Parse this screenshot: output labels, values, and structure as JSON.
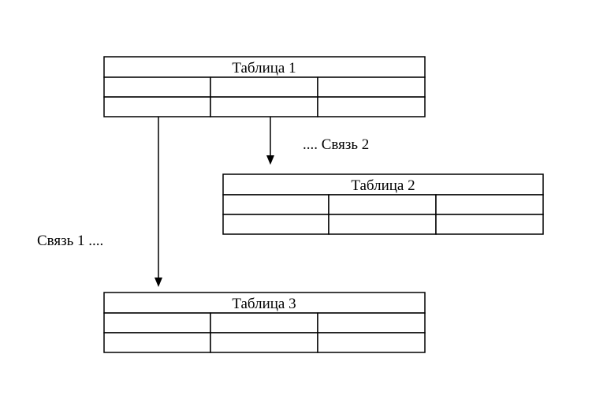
{
  "tables": [
    {
      "title": "Таблица 1"
    },
    {
      "title": "Таблица 2"
    },
    {
      "title": "Таблица 3"
    }
  ],
  "relations": [
    {
      "label": "Связь 1 ...."
    },
    {
      "label": ".... Связь 2"
    }
  ]
}
